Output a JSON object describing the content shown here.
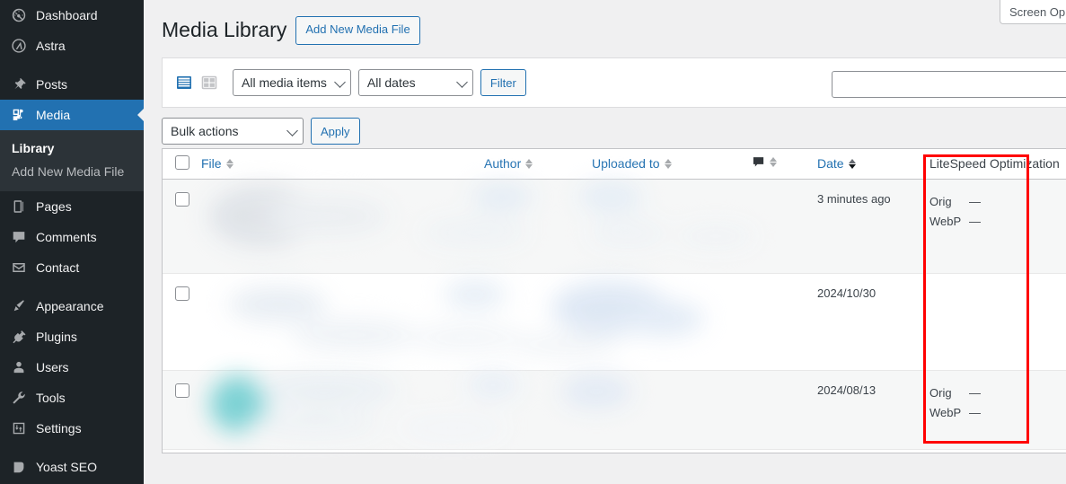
{
  "sidebar": {
    "items": [
      {
        "label": "Dashboard",
        "icon": "dashboard-icon",
        "active": false
      },
      {
        "label": "Astra",
        "icon": "astra-icon",
        "active": false
      },
      {
        "label": "Posts",
        "icon": "pin-icon",
        "active": false
      },
      {
        "label": "Media",
        "icon": "media-icon",
        "active": true
      },
      {
        "label": "Pages",
        "icon": "pages-icon",
        "active": false
      },
      {
        "label": "Comments",
        "icon": "comment-icon",
        "active": false
      },
      {
        "label": "Contact",
        "icon": "envelope-icon",
        "active": false
      },
      {
        "label": "Appearance",
        "icon": "brush-icon",
        "active": false
      },
      {
        "label": "Plugins",
        "icon": "plug-icon",
        "active": false
      },
      {
        "label": "Users",
        "icon": "user-icon",
        "active": false
      },
      {
        "label": "Tools",
        "icon": "wrench-icon",
        "active": false
      },
      {
        "label": "Settings",
        "icon": "sliders-icon",
        "active": false
      },
      {
        "label": "Yoast SEO",
        "icon": "yoast-icon",
        "active": false
      }
    ],
    "submenu": {
      "parent": "Media",
      "items": [
        {
          "label": "Library",
          "current": true
        },
        {
          "label": "Add New Media File",
          "current": false
        }
      ]
    }
  },
  "header": {
    "title": "Media Library",
    "add_new_label": "Add New Media File",
    "screen_options_label": "Screen Op"
  },
  "toolbar": {
    "view_list_label": "List view",
    "view_grid_label": "Grid view",
    "media_filter_value": "All media items",
    "dates_filter_value": "All dates",
    "filter_button_label": "Filter",
    "search_placeholder": "",
    "search_value": ""
  },
  "bulk": {
    "select_value": "Bulk actions",
    "apply_label": "Apply"
  },
  "table": {
    "columns": [
      {
        "key": "cb",
        "label": "",
        "sortable": false,
        "sorted": false
      },
      {
        "key": "file",
        "label": "File",
        "sortable": true,
        "sorted": false
      },
      {
        "key": "author",
        "label": "Author",
        "sortable": true,
        "sorted": false
      },
      {
        "key": "upl",
        "label": "Uploaded to",
        "sortable": true,
        "sorted": false
      },
      {
        "key": "cmt",
        "label": "",
        "sortable": true,
        "sorted": false
      },
      {
        "key": "date",
        "label": "Date",
        "sortable": true,
        "sorted": true
      },
      {
        "key": "lite",
        "label": "LiteSpeed Optimization",
        "sortable": false,
        "sorted": false
      }
    ],
    "rows": [
      {
        "selected": false,
        "file": "",
        "author": "",
        "uploaded_to": "",
        "comments": "",
        "date": "3 minutes ago",
        "litespeed": [
          {
            "label": "Orig",
            "value": "—"
          },
          {
            "label": "WebP",
            "value": "—"
          }
        ]
      },
      {
        "selected": false,
        "file": "",
        "author": "",
        "uploaded_to": "",
        "comments": "",
        "date": "2024/10/30",
        "litespeed": []
      },
      {
        "selected": false,
        "file": "",
        "author": "",
        "uploaded_to": "",
        "comments": "",
        "date": "2024/08/13",
        "litespeed": [
          {
            "label": "Orig",
            "value": "—"
          },
          {
            "label": "WebP",
            "value": "—"
          }
        ]
      }
    ]
  },
  "annotation": {
    "target_column": "Date",
    "color": "#ff0000"
  },
  "colors": {
    "sidebar_bg": "#1d2327",
    "submenu_bg": "#2c3338",
    "accent_blue": "#2271b1",
    "page_bg": "#f0f0f1",
    "row_alt_bg": "#f6f7f7",
    "annotation_red": "#ff0000"
  }
}
